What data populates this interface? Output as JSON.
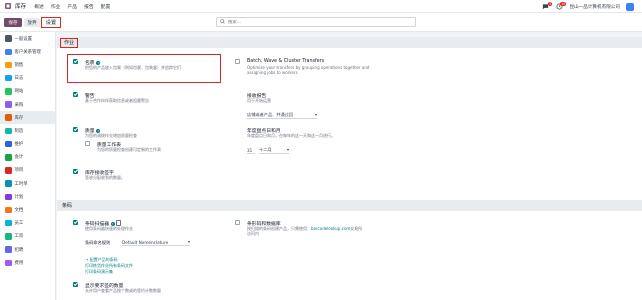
{
  "topbar": {
    "app_name": "库存",
    "menu": [
      "概述",
      "作业",
      "产品",
      "报告",
      "配置"
    ],
    "chat_badge": "5",
    "activity_badge": "10",
    "company": "昆山一品计算机有限公司"
  },
  "control": {
    "save_label": "保存",
    "discard_label": "放弃",
    "breadcrumb": "设置",
    "search_placeholder": "搜索..."
  },
  "sidebar": {
    "items": [
      {
        "label": "一般设置",
        "color": "#4b5563"
      },
      {
        "label": "客户关系管理",
        "color": "#3b82f6"
      },
      {
        "label": "销售",
        "color": "#f59e0b"
      },
      {
        "label": "日志",
        "color": "#0ea5e9"
      },
      {
        "label": "网站",
        "color": "#22c55e"
      },
      {
        "label": "采购",
        "color": "#8b5cf6"
      },
      {
        "label": "库存",
        "color": "#ea580c"
      },
      {
        "label": "制造",
        "color": "#14b8a6"
      },
      {
        "label": "维护",
        "color": "#2563eb"
      },
      {
        "label": "会计",
        "color": "#16a34a"
      },
      {
        "label": "项目",
        "color": "#dc2626"
      },
      {
        "label": "工时单",
        "color": "#0891b2"
      },
      {
        "label": "计划",
        "color": "#7c3aed"
      },
      {
        "label": "文档",
        "color": "#f97316"
      },
      {
        "label": "员工",
        "color": "#06b6d4"
      },
      {
        "label": "工资",
        "color": "#10b981"
      },
      {
        "label": "招聘",
        "color": "#6366f1"
      },
      {
        "label": "费用",
        "color": "#a855f7"
      }
    ],
    "active_index": 6
  },
  "sections": {
    "operations": {
      "title": "作业",
      "packages_title": "包裹",
      "packages_desc_1": "把您的产品放入包裹（例如包裹、包装盒）并追踪它们",
      "batch_title": "Batch, Wave & Cluster Transfers",
      "batch_desc_1": "Optimize your transfers by grouping operations together and",
      "batch_desc_2": "assigning jobs to workers",
      "warnings_title": "警告",
      "warnings_desc": "基于合作伙伴获取信息或者阻塞警告",
      "reception_title": "接收报告",
      "reception_desc": "用于开始运营",
      "reception_select": "店铺或者产品、并通过回",
      "quality_title": "质量",
      "quality_desc": "为您的调拨作业增加质量检查",
      "qwork_title": "质量工作表",
      "qwork_desc": "为您的质量检查创建可定制的工作表",
      "annual_title": "年度盘点日和月",
      "annual_desc": "年度盘点日和月，在每年的这一天和这一月进行。",
      "annual_day": "31",
      "annual_month": "十二月",
      "recv_title": "库存接收签字",
      "recv_desc": "签收分配收到的数量。"
    },
    "barcode": {
      "title": "条码",
      "scanner_title": "条码扫描器",
      "scanner_desc": "使用条码器快速的处理作业",
      "nomenclature_label": "条码命名规则",
      "nomenclature_value": "Default Nomenclature",
      "link_configure": "→ 配置产品的条码",
      "link_print_ops": "打印拣货作业所有条码文件",
      "link_print_barcodes": "打印条码演示集",
      "lookup_title": "条形码和数据库",
      "lookup_desc_1": "按扫描的条码创建产品，只需使用：",
      "lookup_link": "barcodelookup.com",
      "lookup_desc_2": "交易所",
      "lookup_desc_3": "访问内",
      "qty_title": "显示要求签的数量",
      "qty_desc": "允许用户查看产品按个数或的签约计数数量"
    }
  }
}
